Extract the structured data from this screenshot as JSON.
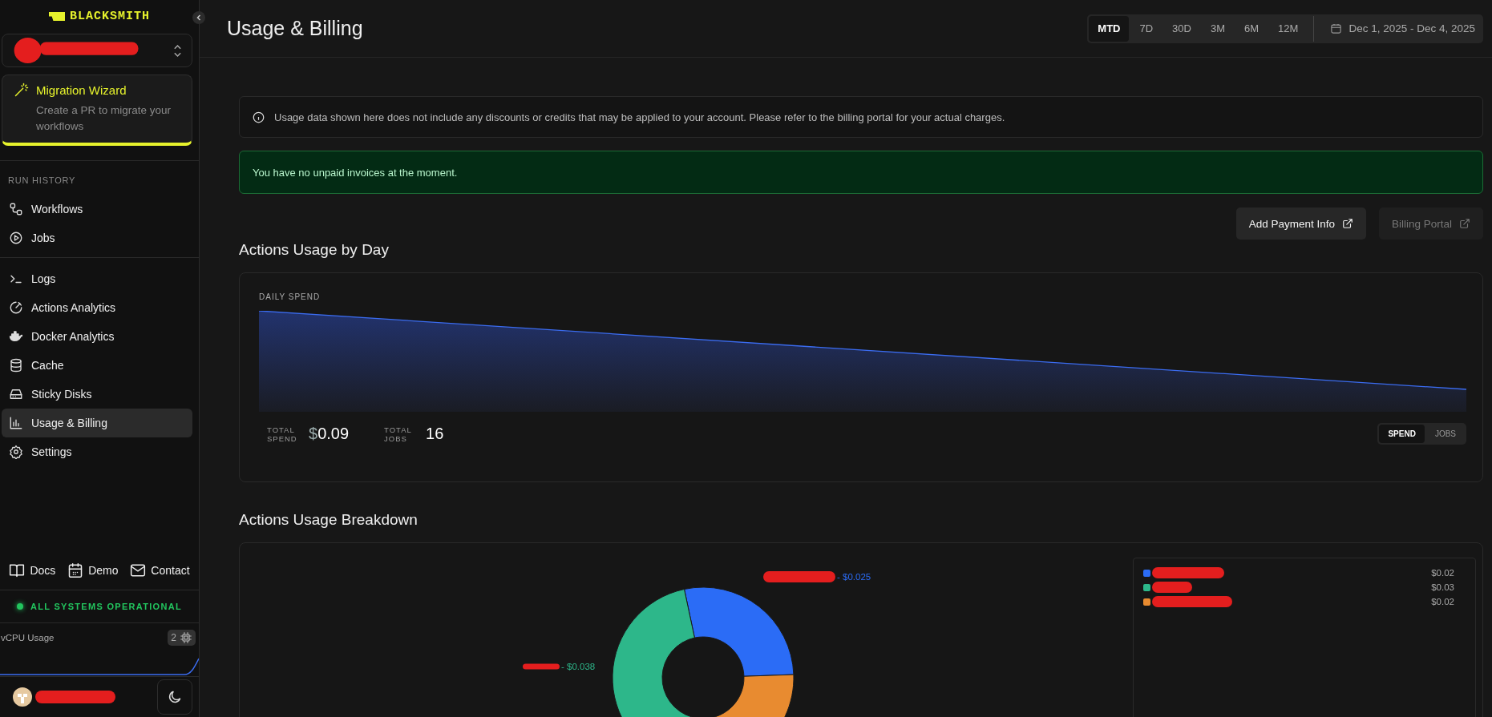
{
  "sidebar": {
    "logo": "BLACKSMITH",
    "promo": {
      "title": "Migration Wizard",
      "text": "Create a PR to migrate your workflows"
    },
    "sections": [
      {
        "heading": "RUN HISTORY",
        "items": [
          {
            "label": "Workflows",
            "selected": false
          },
          {
            "label": "Jobs",
            "selected": false
          }
        ]
      },
      {
        "items": [
          {
            "label": "Logs",
            "selected": false
          },
          {
            "label": "Actions Analytics",
            "selected": false
          },
          {
            "label": "Docker Analytics",
            "selected": false
          },
          {
            "label": "Cache",
            "selected": false
          },
          {
            "label": "Sticky Disks",
            "selected": false
          },
          {
            "label": "Usage & Billing",
            "selected": true
          },
          {
            "label": "Settings",
            "selected": false
          }
        ]
      }
    ],
    "links": [
      {
        "label": "Docs"
      },
      {
        "label": "Demo"
      },
      {
        "label": "Contact"
      }
    ],
    "status": {
      "text": "ALL SYSTEMS OPERATIONAL",
      "color": "#22c55e"
    },
    "vcpu": {
      "label": "vCPU Usage",
      "count": "2"
    }
  },
  "header": {
    "title": "Usage & Billing",
    "periods": [
      {
        "label": "MTD",
        "selected": true
      },
      {
        "label": "7D",
        "selected": false
      },
      {
        "label": "30D",
        "selected": false
      },
      {
        "label": "3M",
        "selected": false
      },
      {
        "label": "6M",
        "selected": false
      },
      {
        "label": "12M",
        "selected": false
      }
    ],
    "date_range": "Dec 1, 2025 - Dec 4, 2025"
  },
  "notice": "Usage data shown here does not include any discounts or credits that may be applied to your account. Please refer to the billing portal for your actual charges.",
  "alert": "You have no unpaid invoices at the moment.",
  "buttons": [
    {
      "label": "Add Payment Info",
      "disabled": false
    },
    {
      "label": "Billing Portal",
      "disabled": true
    }
  ],
  "daily": {
    "title": "Actions Usage by Day",
    "chart_label": "DAILY SPEND",
    "stats": [
      {
        "label": "TOTAL SPEND",
        "currency": "$",
        "value": "0.09"
      },
      {
        "label": "TOTAL JOBS",
        "value": "16"
      }
    ],
    "toggle": [
      {
        "label": "SPEND",
        "selected": true
      },
      {
        "label": "JOBS",
        "selected": false
      }
    ]
  },
  "breakdown": {
    "title": "Actions Usage Breakdown",
    "slice_labels": [
      {
        "text": "- $0.025",
        "color": "#2b6cf6"
      },
      {
        "text": "- $0.038",
        "color": "#2db78a"
      }
    ],
    "legend": [
      {
        "color": "#2b6cf6",
        "amount": "$0.02"
      },
      {
        "color": "#2db78a",
        "amount": "$0.03"
      },
      {
        "color": "#e88b30",
        "amount": "$0.02"
      }
    ]
  }
}
